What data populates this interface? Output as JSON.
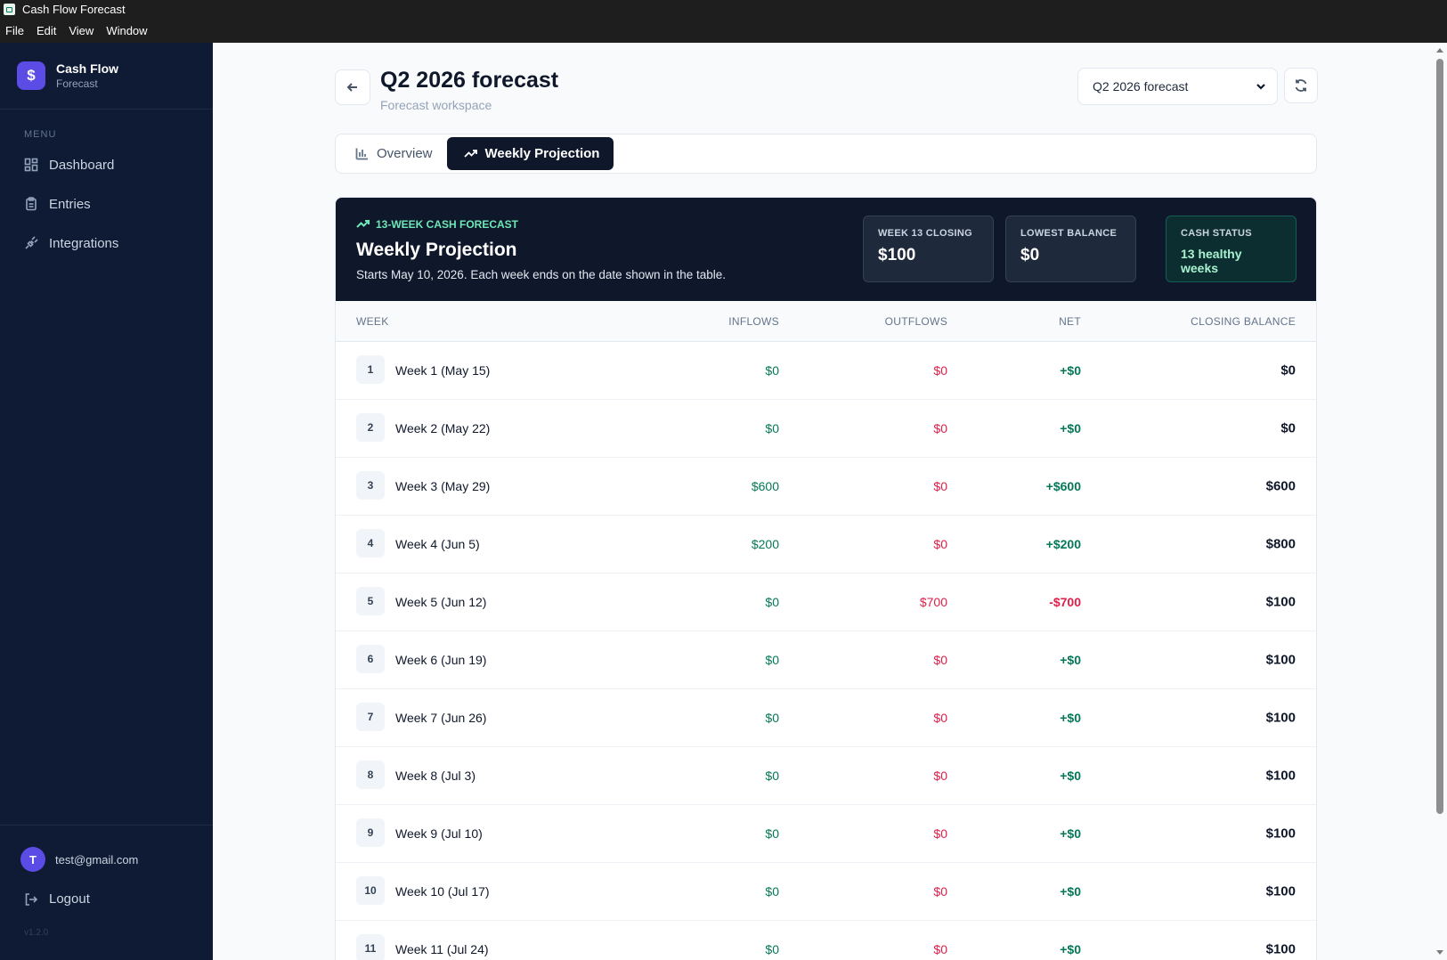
{
  "window": {
    "title": "Cash Flow Forecast"
  },
  "menubar": {
    "items": [
      "File",
      "Edit",
      "View",
      "Window"
    ]
  },
  "sidebar": {
    "brand_name": "Cash Flow",
    "brand_sub": "Forecast",
    "brand_icon": "$",
    "menu_label": "MENU",
    "items": [
      {
        "label": "Dashboard",
        "icon": "grid-icon"
      },
      {
        "label": "Entries",
        "icon": "clipboard-icon"
      },
      {
        "label": "Integrations",
        "icon": "plug-icon"
      }
    ],
    "user": {
      "initial": "T",
      "email": "test@gmail.com"
    },
    "logout_label": "Logout",
    "version": "v1.2.0"
  },
  "header": {
    "title": "Q2 2026 forecast",
    "subtitle": "Forecast workspace",
    "select_value": "Q2 2026 forecast"
  },
  "tabs": [
    {
      "label": "Overview",
      "active": false
    },
    {
      "label": "Weekly Projection",
      "active": true
    }
  ],
  "hero": {
    "eyebrow": "13-WEEK CASH FORECAST",
    "title": "Weekly Projection",
    "description": "Starts May 10, 2026. Each week ends on the date shown in the table.",
    "stats": [
      {
        "label": "WEEK 13 CLOSING",
        "value": "$100"
      },
      {
        "label": "LOWEST BALANCE",
        "value": "$0"
      },
      {
        "label": "CASH STATUS",
        "value": "13 healthy weeks"
      }
    ]
  },
  "table": {
    "headers": {
      "week": "WEEK",
      "inflows": "INFLOWS",
      "outflows": "OUTFLOWS",
      "net": "NET",
      "closing": "CLOSING BALANCE"
    },
    "rows": [
      {
        "num": "1",
        "label": "Week 1 (May 15)",
        "inflows": "$0",
        "outflows": "$0",
        "net": "+$0",
        "closing": "$0"
      },
      {
        "num": "2",
        "label": "Week 2 (May 22)",
        "inflows": "$0",
        "outflows": "$0",
        "net": "+$0",
        "closing": "$0"
      },
      {
        "num": "3",
        "label": "Week 3 (May 29)",
        "inflows": "$600",
        "outflows": "$0",
        "net": "+$600",
        "closing": "$600"
      },
      {
        "num": "4",
        "label": "Week 4 (Jun 5)",
        "inflows": "$200",
        "outflows": "$0",
        "net": "+$200",
        "closing": "$800"
      },
      {
        "num": "5",
        "label": "Week 5 (Jun 12)",
        "inflows": "$0",
        "outflows": "$700",
        "net": "-$700",
        "closing": "$100"
      },
      {
        "num": "6",
        "label": "Week 6 (Jun 19)",
        "inflows": "$0",
        "outflows": "$0",
        "net": "+$0",
        "closing": "$100"
      },
      {
        "num": "7",
        "label": "Week 7 (Jun 26)",
        "inflows": "$0",
        "outflows": "$0",
        "net": "+$0",
        "closing": "$100"
      },
      {
        "num": "8",
        "label": "Week 8 (Jul 3)",
        "inflows": "$0",
        "outflows": "$0",
        "net": "+$0",
        "closing": "$100"
      },
      {
        "num": "9",
        "label": "Week 9 (Jul 10)",
        "inflows": "$0",
        "outflows": "$0",
        "net": "+$0",
        "closing": "$100"
      },
      {
        "num": "10",
        "label": "Week 10 (Jul 17)",
        "inflows": "$0",
        "outflows": "$0",
        "net": "+$0",
        "closing": "$100"
      },
      {
        "num": "11",
        "label": "Week 11 (Jul 24)",
        "inflows": "$0",
        "outflows": "$0",
        "net": "+$0",
        "closing": "$100"
      }
    ]
  },
  "colors": {
    "accent": "#5b4ce6",
    "positive": "#047857",
    "negative": "#e11d48",
    "sidebar_bg": "#0f1a35",
    "hero_bg": "#0f172a"
  }
}
